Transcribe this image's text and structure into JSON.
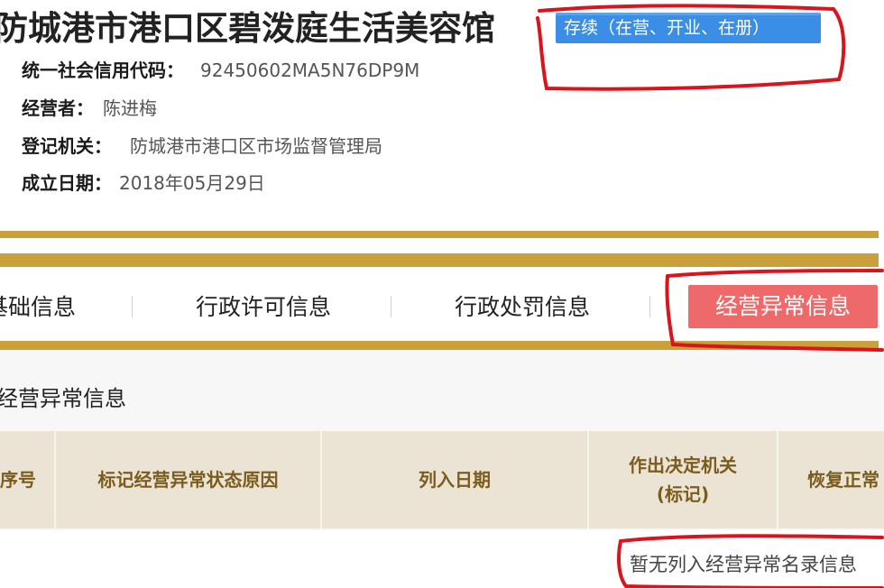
{
  "company": {
    "name": "防城港市港口区碧泼庭生活美容馆",
    "status": "存续（在营、开业、在册）"
  },
  "info": [
    {
      "label": "统一社会信用代码：",
      "value": "92450602MA5N76DP9M"
    },
    {
      "label": "经营者：",
      "value": "陈进梅"
    },
    {
      "label": "登记机关：",
      "value": "防城港市港口区市场监督管理局"
    },
    {
      "label": "成立日期：",
      "value": "2018年05月29日"
    }
  ],
  "tabs": [
    {
      "label": "基础信息"
    },
    {
      "label": "行政许可信息"
    },
    {
      "label": "行政处罚信息"
    },
    {
      "label": "经营异常信息"
    }
  ],
  "section": {
    "title": "经营异常信息"
  },
  "table": {
    "headers": [
      "序号",
      "标记经营异常状态原因",
      "列入日期",
      "作出决定机关\n(标记)",
      "恢复正常"
    ],
    "empty_message": "暂无列入经营异常名录信息"
  },
  "colors": {
    "gold": "#c9a03c",
    "status_blue": "#3a8ee6",
    "active_tab": "#ee6a6a",
    "annotation_red": "#d9141c"
  }
}
